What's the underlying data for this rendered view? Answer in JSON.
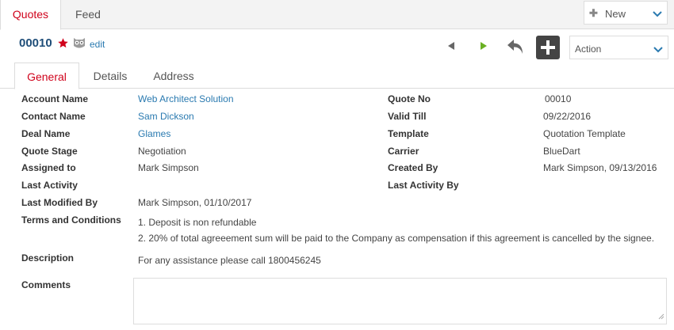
{
  "top_tabs": [
    {
      "label": "Quotes"
    },
    {
      "label": "Feed"
    }
  ],
  "new_button": {
    "label": "New",
    "icon": "plus-icon"
  },
  "record": {
    "number": "00010",
    "edit_label": "edit"
  },
  "action_select": {
    "label": "Action"
  },
  "sub_tabs": [
    {
      "label": "General"
    },
    {
      "label": "Details"
    },
    {
      "label": "Address"
    }
  ],
  "fields_left": [
    {
      "label": "Account Name",
      "value": "Web Architect Solution"
    },
    {
      "label": "Contact Name",
      "value": "Sam Dickson"
    },
    {
      "label": "Deal Name",
      "value": "Glames"
    },
    {
      "label": "Quote Stage",
      "value": "Negotiation"
    },
    {
      "label": "Assigned to",
      "value": "Mark Simpson"
    },
    {
      "label": "Last Activity",
      "value": ""
    },
    {
      "label": "Last Modified By",
      "value": "Mark Simpson, 01/10/2017"
    }
  ],
  "fields_right": [
    {
      "label": "Quote No",
      "value": "00010"
    },
    {
      "label": "Valid Till",
      "value": "09/22/2016"
    },
    {
      "label": "Template",
      "value": "Quotation Template"
    },
    {
      "label": "Carrier",
      "value": "BlueDart"
    },
    {
      "label": "Created By",
      "value": "Mark Simpson, 09/13/2016"
    },
    {
      "label": "Last Activity By",
      "value": ""
    }
  ],
  "terms": {
    "label": "Terms and Conditions",
    "lines": [
      "1. Deposit is non refundable",
      "2. 20% of total agreeement sum will be paid to the Company as compensation if this agreement is cancelled by the signee."
    ]
  },
  "description": {
    "label": "Description",
    "value": "For any assistance please call 1800456245"
  },
  "comments": {
    "label": "Comments",
    "value": ""
  },
  "colors": {
    "accent_red": "#d0021b",
    "link_blue": "#2a7ab0",
    "record_blue": "#1f4e79",
    "next_green": "#6ab023"
  }
}
